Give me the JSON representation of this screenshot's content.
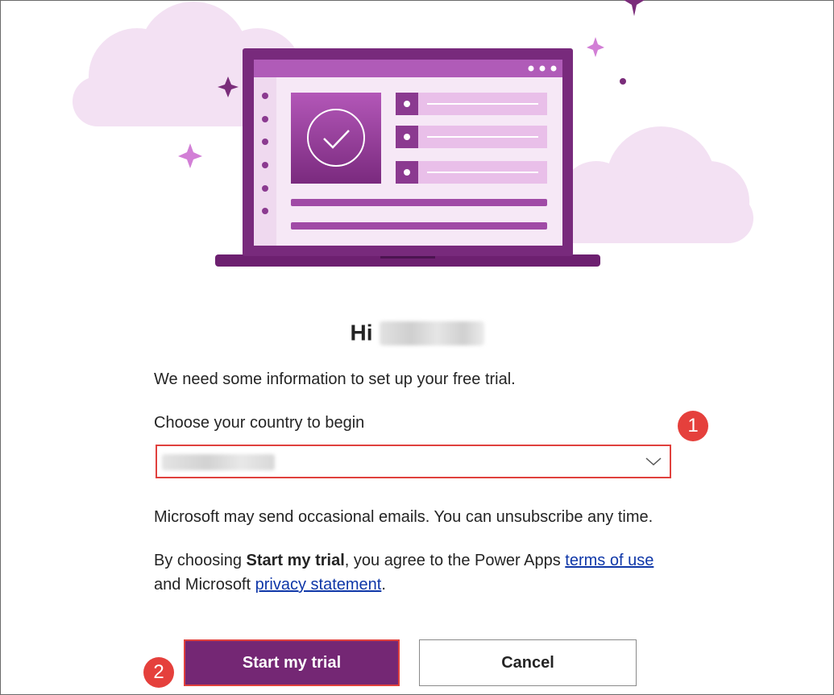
{
  "greeting": {
    "prefix": "Hi"
  },
  "intro_text": "We need some information to set up your free trial.",
  "country": {
    "label": "Choose your country to begin",
    "chevron_icon": "chevron-down-icon"
  },
  "emails_notice": "Microsoft may send occasional emails. You can unsubscribe any time.",
  "consent": {
    "part1": "By choosing ",
    "bold": "Start my trial",
    "part2": ", you agree to the Power Apps ",
    "terms_link": "terms of use",
    "part3": " and Microsoft ",
    "privacy_link": "privacy statement",
    "part4": "."
  },
  "buttons": {
    "start_label": "Start my trial",
    "cancel_label": "Cancel"
  },
  "markers": {
    "one": "1",
    "two": "2"
  },
  "colors": {
    "brand_purple": "#742774",
    "highlight_red": "#e0413d",
    "link_blue": "#0f37a8",
    "cloud_pink": "#f2e1f2"
  }
}
